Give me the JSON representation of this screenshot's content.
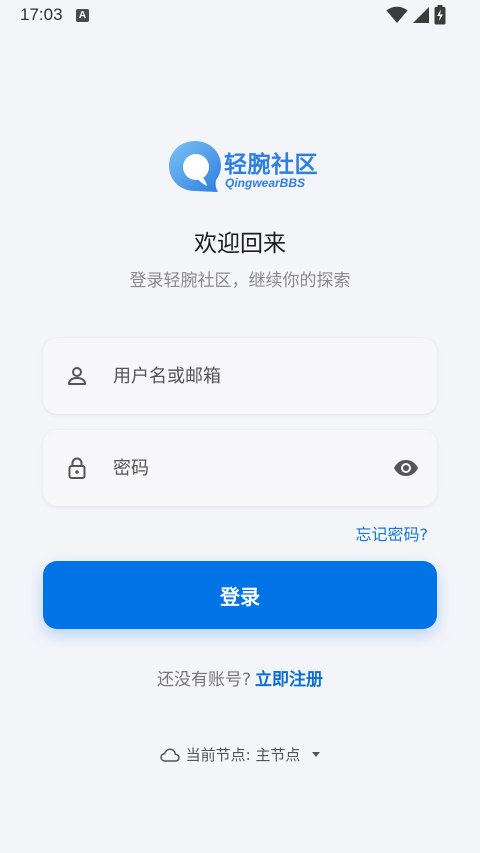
{
  "status_bar": {
    "time": "17:03",
    "notification_badge": "A",
    "icons": [
      "wifi-icon",
      "cellular-signal-icon",
      "battery-charging-icon"
    ]
  },
  "brand": {
    "name": "轻腕社区",
    "subname": "QingwearBBS",
    "accent_color": "#2f7fe0"
  },
  "header": {
    "title": "欢迎回来",
    "subtitle": "登录轻腕社区，继续你的探索"
  },
  "form": {
    "username": {
      "placeholder": "用户名或邮箱",
      "value": "",
      "icon": "person-icon"
    },
    "password": {
      "placeholder": "密码",
      "value": "",
      "icon": "lock-icon",
      "toggle_icon": "eye-icon"
    },
    "forgot_password": "忘记密码?",
    "login_button": "登录",
    "login_button_color": "#0073e6"
  },
  "register": {
    "prompt": "还没有账号?",
    "link": "立即注册"
  },
  "server": {
    "label": "当前节点: 主节点",
    "icon": "cloud-icon"
  }
}
